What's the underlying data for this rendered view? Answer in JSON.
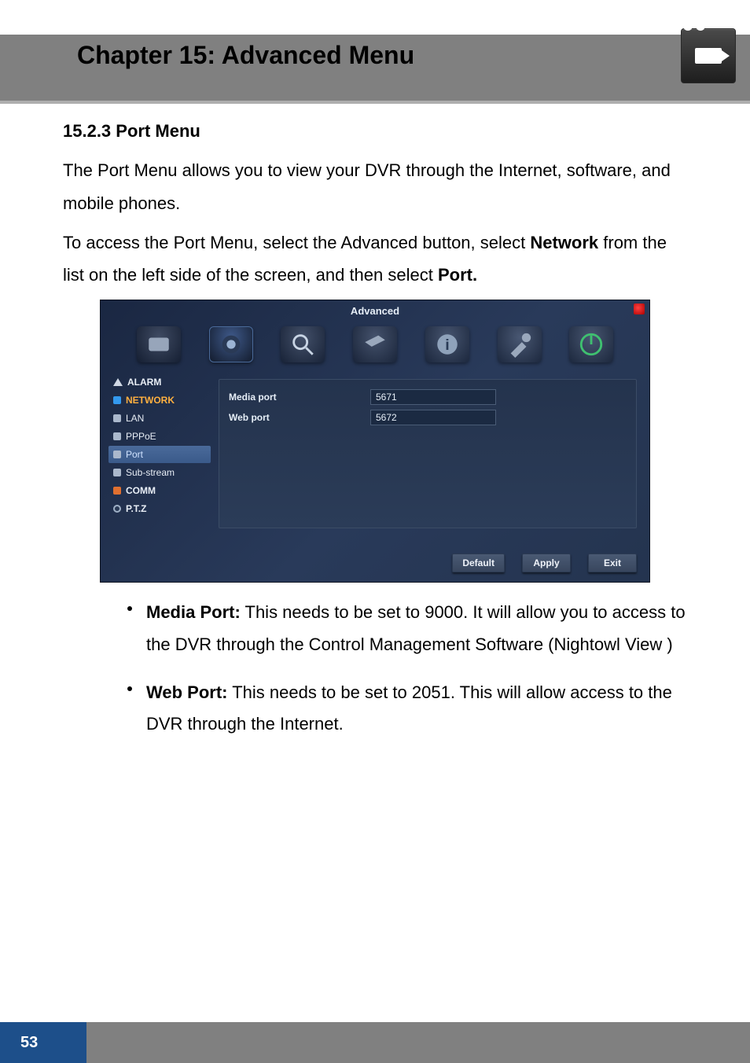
{
  "header": {
    "chapter_title": "Chapter 15: Advanced Menu"
  },
  "section": {
    "number_title": "15.2.3 Port Menu"
  },
  "intro": {
    "p1": "The Port Menu allows you to view your DVR through the Internet, software, and mobile phones.",
    "p2a": "To access the Port Menu, select the Advanced button, select ",
    "p2_bold1": "Network",
    "p2b": " from the list on the left side of the screen, and then select ",
    "p2_bold2": "Port."
  },
  "screenshot": {
    "window_title": "Advanced",
    "top_icons": [
      "tools",
      "camera",
      "search",
      "hdd",
      "info",
      "maintenance",
      "power"
    ],
    "sidebar": {
      "alarm": "ALARM",
      "network": "NETWORK",
      "lan": "LAN",
      "pppoe": "PPPoE",
      "port": "Port",
      "substream": "Sub-stream",
      "comm": "COMM",
      "ptz": "P.T.Z"
    },
    "fields": {
      "media_port_label": "Media port",
      "media_port_value": "5671",
      "web_port_label": "Web port",
      "web_port_value": "5672"
    },
    "buttons": {
      "default": "Default",
      "apply": "Apply",
      "exit": "Exit"
    }
  },
  "bullets": {
    "b1_strong": "Media Port:",
    "b1_text": " This needs to be set to 9000. It will allow you to access to the DVR through the Control Management Software (Nightowl View )",
    "b2_strong": "Web Port:",
    "b2_text": " This needs to be set to 2051. This will allow access to the DVR through the Internet."
  },
  "footer": {
    "page_number": "53"
  }
}
